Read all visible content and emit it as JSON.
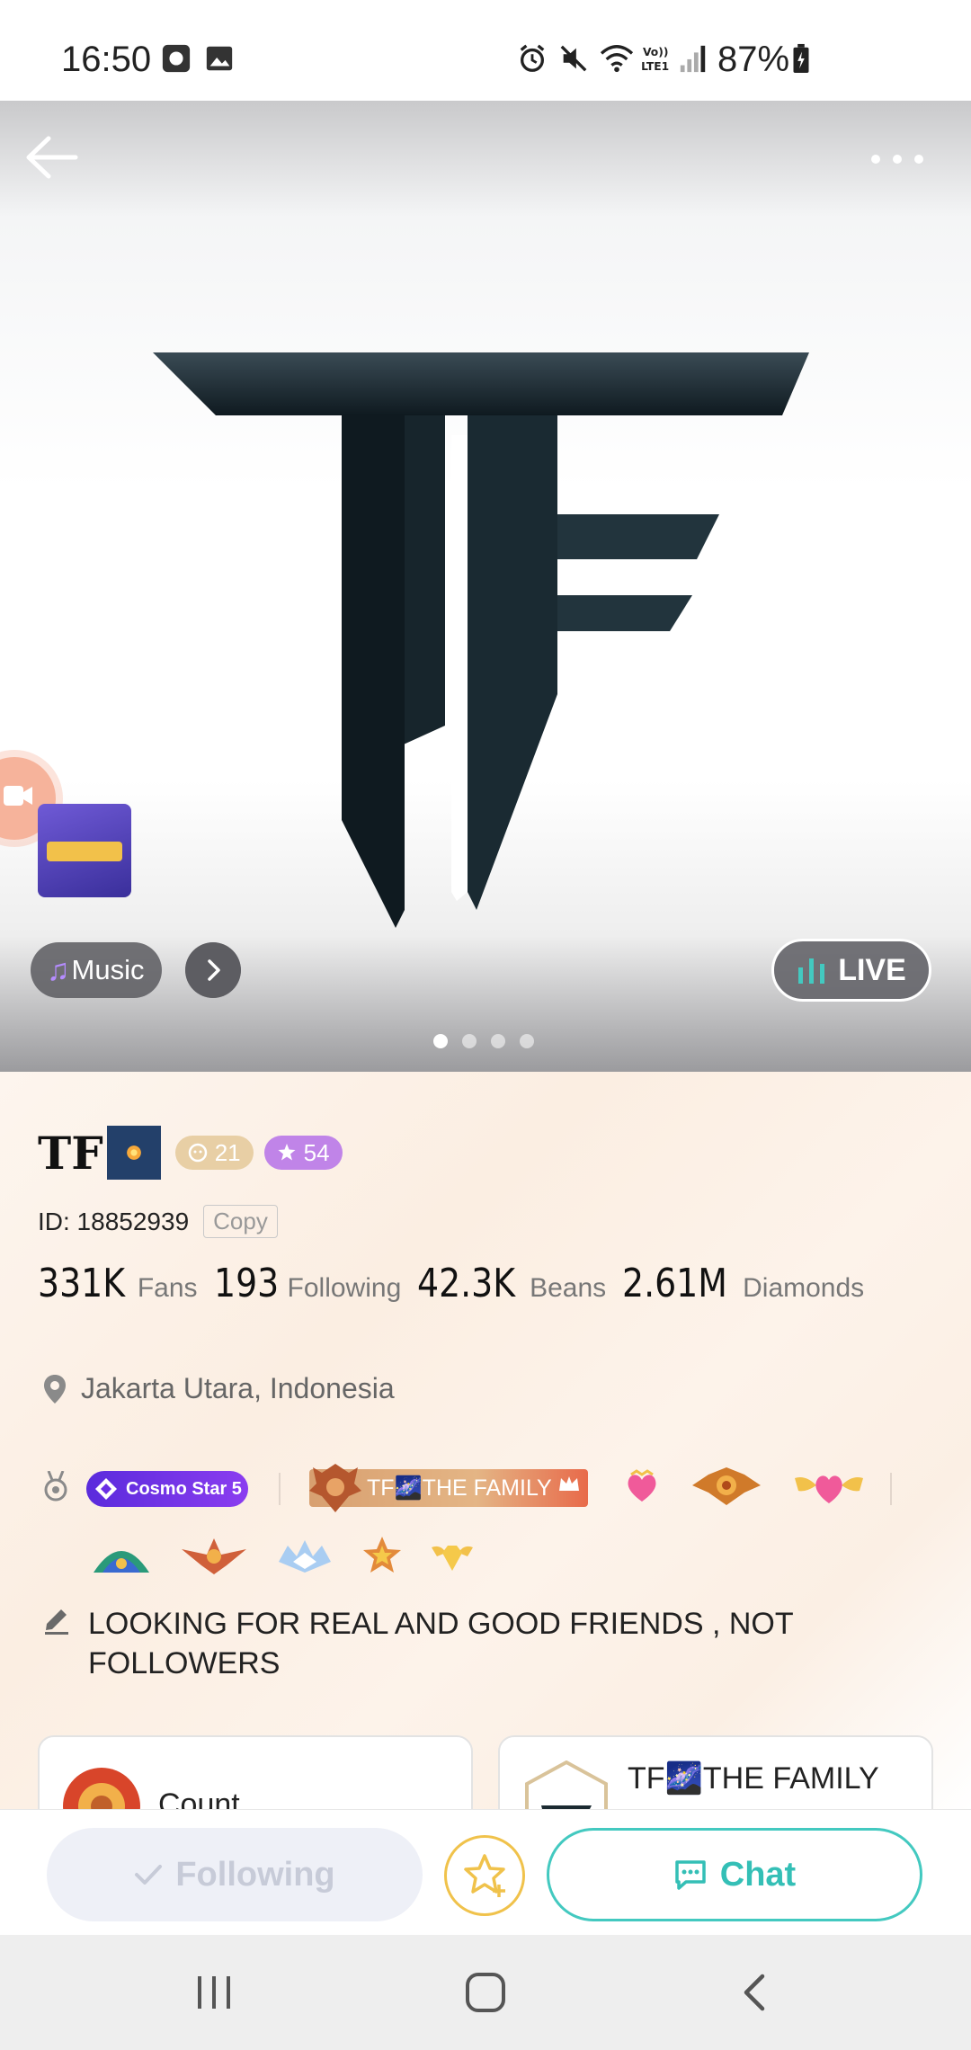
{
  "status_bar": {
    "time": "16:50",
    "battery": "87%"
  },
  "cover": {
    "music_label": "Music",
    "live_label": "LIVE",
    "pages": 4,
    "active_page": 1
  },
  "profile": {
    "name": "TF",
    "level": "21",
    "star_level": "54",
    "id_text": "ID: 18852939",
    "copy_label": "Copy",
    "stats": [
      {
        "value": "331K",
        "label": "Fans"
      },
      {
        "value": "193",
        "label": "Following"
      },
      {
        "value": "42.3K",
        "label": "Beans"
      },
      {
        "value": "2.61M",
        "label": "Diamonds"
      }
    ],
    "location": "Jakarta Utara, Indonesia",
    "cosmo_badge": "Cosmo Star 5",
    "family_badge": "TF🌌THE FAMILY",
    "bio": "LOOKING FOR REAL AND GOOD FRIENDS , NOT FOLLOWERS"
  },
  "cards": {
    "left_title": "Count",
    "right_title": "TF🌌THE FAMILY"
  },
  "actions": {
    "following_label": "Following",
    "chat_label": "Chat"
  },
  "colors": {
    "accent_teal": "#34bfb6",
    "star_gold": "#f0c24b",
    "cosmo_purple": "#6a2fe4"
  }
}
